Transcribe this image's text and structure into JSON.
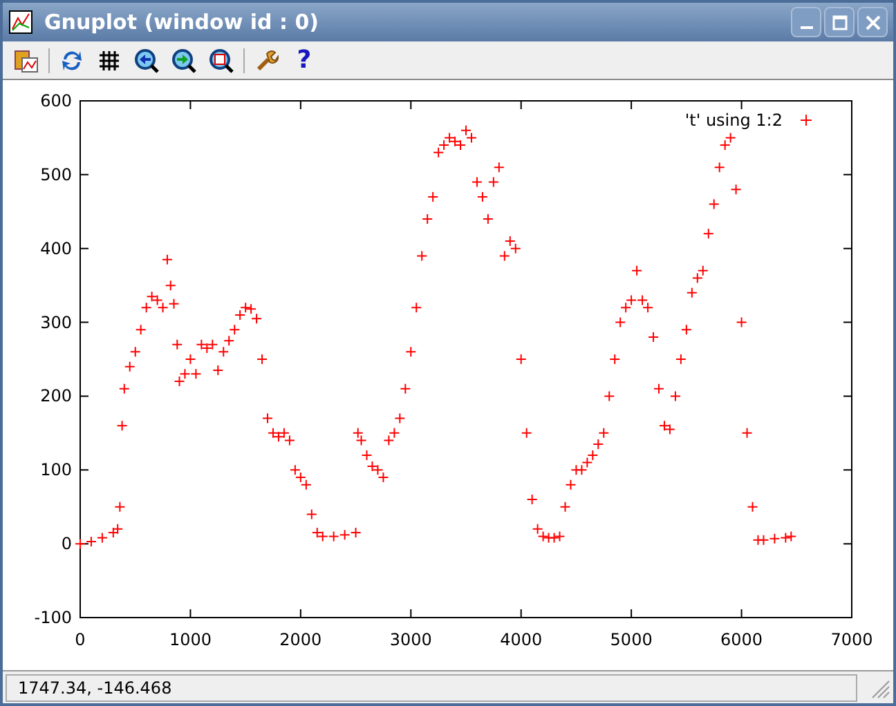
{
  "window": {
    "title": "Gnuplot (window id : 0)"
  },
  "toolbar": {
    "help_glyph": "?"
  },
  "plot": {
    "chart_data": {
      "type": "scatter",
      "xlim": [
        0,
        7000
      ],
      "ylim": [
        -100,
        600
      ],
      "xticks": [
        0,
        1000,
        2000,
        3000,
        4000,
        5000,
        6000,
        7000
      ],
      "yticks": [
        -100,
        0,
        100,
        200,
        300,
        400,
        500,
        600
      ],
      "x": [
        0,
        100,
        200,
        300,
        340,
        360,
        380,
        400,
        450,
        500,
        550,
        600,
        650,
        700,
        750,
        790,
        820,
        850,
        880,
        900,
        950,
        1000,
        1050,
        1100,
        1150,
        1200,
        1250,
        1300,
        1350,
        1400,
        1450,
        1500,
        1550,
        1600,
        1650,
        1700,
        1750,
        1800,
        1850,
        1900,
        1950,
        2000,
        2050,
        2100,
        2150,
        2200,
        2300,
        2400,
        2500,
        2520,
        2550,
        2600,
        2650,
        2700,
        2750,
        2800,
        2850,
        2900,
        2950,
        3000,
        3050,
        3100,
        3150,
        3200,
        3250,
        3300,
        3350,
        3400,
        3450,
        3500,
        3550,
        3600,
        3650,
        3700,
        3750,
        3800,
        3850,
        3900,
        3950,
        4000,
        4050,
        4100,
        4150,
        4200,
        4250,
        4300,
        4350,
        4400,
        4450,
        4500,
        4550,
        4600,
        4650,
        4700,
        4750,
        4800,
        4850,
        4900,
        4950,
        5000,
        5050,
        5100,
        5150,
        5200,
        5250,
        5300,
        5350,
        5400,
        5450,
        5500,
        5550,
        5600,
        5650,
        5700,
        5750,
        5800,
        5850,
        5900,
        5950,
        6000,
        6050,
        6100,
        6150,
        6200,
        6300,
        6400,
        6450
      ],
      "series": [
        {
          "name": "'t' using 1:2",
          "color": "#ff0000",
          "values": [
            0,
            3,
            8,
            15,
            20,
            50,
            160,
            210,
            240,
            260,
            290,
            320,
            335,
            330,
            320,
            385,
            350,
            325,
            270,
            220,
            230,
            250,
            230,
            270,
            265,
            270,
            235,
            260,
            275,
            290,
            310,
            320,
            318,
            305,
            250,
            170,
            150,
            145,
            150,
            140,
            100,
            90,
            80,
            40,
            15,
            10,
            10,
            12,
            15,
            150,
            140,
            120,
            105,
            100,
            90,
            140,
            150,
            170,
            210,
            260,
            320,
            390,
            440,
            470,
            530,
            540,
            550,
            545,
            540,
            560,
            550,
            490,
            470,
            440,
            490,
            510,
            390,
            410,
            400,
            250,
            150,
            60,
            20,
            10,
            8,
            8,
            10,
            50,
            80,
            100,
            100,
            110,
            120,
            135,
            150,
            200,
            250,
            300,
            320,
            330,
            370,
            330,
            320,
            280,
            210,
            160,
            155,
            200,
            250,
            290,
            340,
            360,
            370,
            420,
            460,
            510,
            540,
            550,
            480,
            300,
            150,
            50,
            5,
            5,
            7,
            8,
            10
          ]
        }
      ]
    }
  },
  "status_bar": {
    "text": "1747.34, -146.468"
  }
}
